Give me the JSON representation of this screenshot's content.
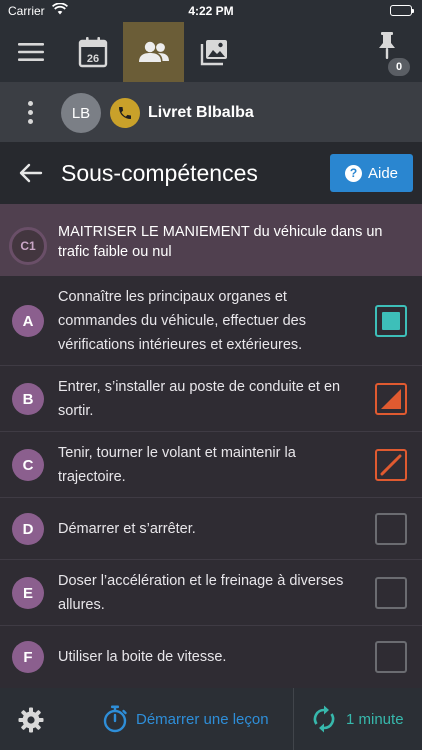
{
  "status_bar": {
    "carrier": "Carrier",
    "time": "4:22 PM"
  },
  "top_nav": {
    "calendar_day": "26",
    "pinned_count": "0"
  },
  "student": {
    "initials": "LB",
    "name": "Livret Blbalba"
  },
  "page": {
    "title": "Sous-compétences",
    "help_label": "Aide",
    "help_icon_glyph": "?"
  },
  "competence": {
    "code": "C1",
    "title": "MAITRISER LE MANIEMENT du véhicule dans un trafic faible ou nul"
  },
  "subskills": [
    {
      "letter": "A",
      "label": "Connaître les principaux organes et commandes du véhicule, effectuer des vérifications intérieures et extérieures.",
      "state": "full"
    },
    {
      "letter": "B",
      "label": "Entrer, s’installer au poste de conduite et en sortir.",
      "state": "half"
    },
    {
      "letter": "C",
      "label": "Tenir, tourner le volant et maintenir la trajectoire.",
      "state": "slash"
    },
    {
      "letter": "D",
      "label": "Démarrer et s’arrêter.",
      "state": "empty"
    },
    {
      "letter": "E",
      "label": "Doser l’accélération et le freinage à diverses allures.",
      "state": "empty"
    },
    {
      "letter": "F",
      "label": "Utiliser la boite de vitesse.",
      "state": "empty"
    }
  ],
  "bottom_bar": {
    "start_lesson_label": "Démarrer une leçon",
    "sync_label": "1 minute"
  },
  "colors": {
    "accent_blue": "#2a86d0",
    "nav_active": "#6b5d37",
    "phone_yellow": "#c9a12a",
    "competence_bg": "#50404f",
    "letter_purple": "#8b5f8e",
    "state_full": "#3dbfb9",
    "state_partial": "#e05a30",
    "sync_teal": "#37b8ac"
  }
}
